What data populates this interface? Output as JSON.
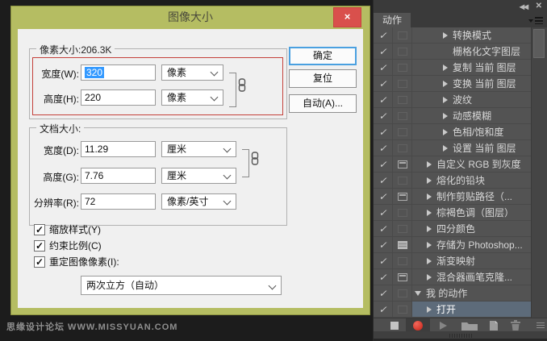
{
  "workspace": {
    "watermark": "思缘设计论坛 WWW.MISSYUAN.COM"
  },
  "dialog": {
    "title": "图像大小",
    "close_glyph": "×",
    "pixel_group": {
      "label": "像素大小:206.3K",
      "width": {
        "label": "宽度(W):",
        "value": "320",
        "unit": "像素",
        "value_selected": true
      },
      "height": {
        "label": "高度(H):",
        "value": "220",
        "unit": "像素"
      }
    },
    "doc_group": {
      "label": "文档大小:",
      "width": {
        "label": "宽度(D):",
        "value": "11.29",
        "unit": "厘米"
      },
      "height": {
        "label": "高度(G):",
        "value": "7.76",
        "unit": "厘米"
      },
      "resolution": {
        "label": "分辨率(R):",
        "value": "72",
        "unit": "像素/英寸"
      }
    },
    "checkboxes": [
      {
        "label": "缩放样式(Y)",
        "checked": true
      },
      {
        "label": "约束比例(C)",
        "checked": true
      },
      {
        "label": "重定图像像素(I):",
        "checked": true
      }
    ],
    "check_glyph": "✓",
    "resample_value": "两次立方（自动）",
    "buttons": {
      "ok": "确定",
      "reset": "复位",
      "auto": "自动(A)..."
    },
    "colors": {
      "accent": "#b5bd62",
      "close_red": "#d9504c",
      "annotation_red": "#c4413b",
      "selection_blue": "#3399ff"
    }
  },
  "actions_panel": {
    "tab": "动作",
    "collapse_glyph": "◂◂",
    "close_glyph": "✕",
    "check_glyph": "✓",
    "rows": [
      {
        "name": "转换模式",
        "level": 3,
        "arrow": "right",
        "dialog": "off",
        "checked": true
      },
      {
        "name": "栅格化文字图层",
        "level": 3,
        "arrow": "none",
        "dialog": "off",
        "checked": true
      },
      {
        "name": "复制 当前 图层",
        "level": 3,
        "arrow": "right",
        "dialog": "off",
        "checked": true
      },
      {
        "name": "变换 当前 图层",
        "level": 3,
        "arrow": "right",
        "dialog": "off",
        "checked": true
      },
      {
        "name": "波纹",
        "level": 3,
        "arrow": "right",
        "dialog": "off",
        "checked": true
      },
      {
        "name": "动感模糊",
        "level": 3,
        "arrow": "right",
        "dialog": "off",
        "checked": true
      },
      {
        "name": "色相/饱和度",
        "level": 3,
        "arrow": "right",
        "dialog": "off",
        "checked": true
      },
      {
        "name": "设置 当前 图层",
        "level": 3,
        "arrow": "right",
        "dialog": "off",
        "checked": true
      },
      {
        "name": "自定义 RGB 到灰度",
        "level": 2,
        "arrow": "right",
        "dialog": "on",
        "checked": true
      },
      {
        "name": "熔化的铅块",
        "level": 2,
        "arrow": "right",
        "dialog": "off",
        "checked": true
      },
      {
        "name": "制作剪贴路径（...",
        "level": 2,
        "arrow": "right",
        "dialog": "on",
        "checked": true
      },
      {
        "name": "棕褐色调（图层）",
        "level": 2,
        "arrow": "right",
        "dialog": "off",
        "checked": true
      },
      {
        "name": "四分颜色",
        "level": 2,
        "arrow": "right",
        "dialog": "off",
        "checked": true
      },
      {
        "name": "存储为 Photoshop...",
        "level": 2,
        "arrow": "right",
        "dialog": "filled",
        "checked": true
      },
      {
        "name": "渐变映射",
        "level": 2,
        "arrow": "right",
        "dialog": "off",
        "checked": true
      },
      {
        "name": "混合器画笔克隆...",
        "level": 2,
        "arrow": "right",
        "dialog": "on",
        "checked": true
      },
      {
        "name": "我 的动作",
        "level": 1,
        "arrow": "down",
        "dialog": "off",
        "checked": true
      },
      {
        "name": "打开",
        "level": 2,
        "arrow": "right",
        "dialog": "off",
        "checked": true,
        "selected": true
      }
    ],
    "toolbar": {
      "record_active": true
    }
  }
}
